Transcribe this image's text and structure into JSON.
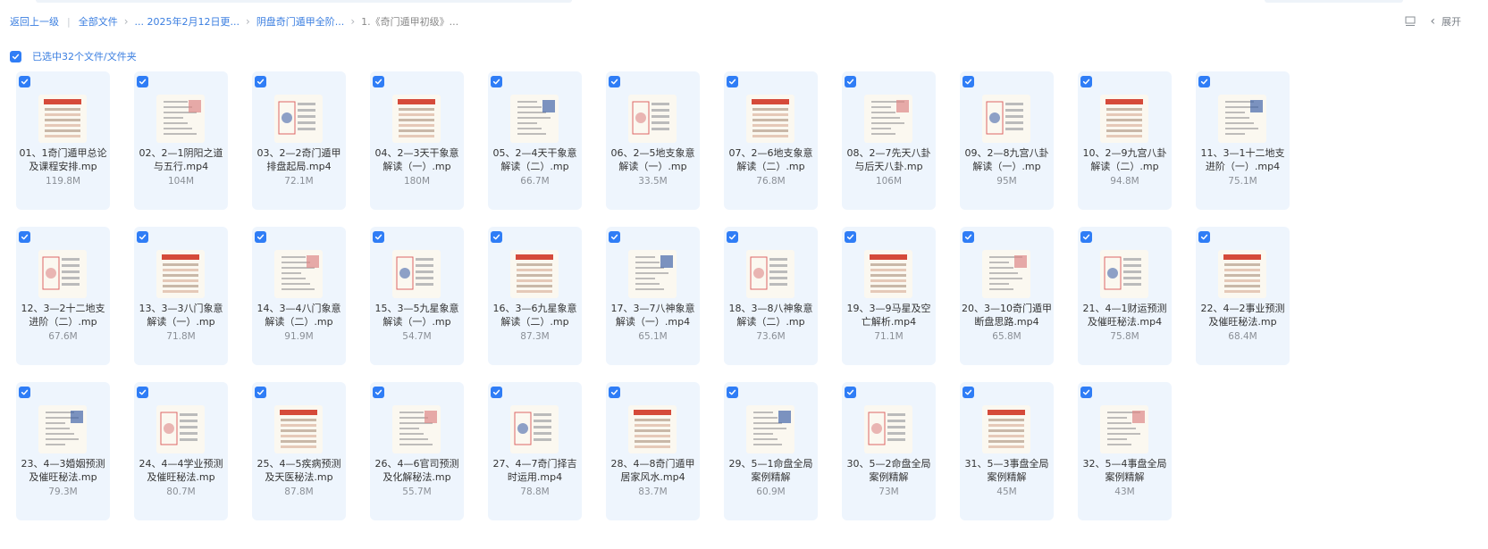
{
  "breadcrumb": {
    "back": "返回上一级",
    "items": [
      "全部文件",
      "... 2025年2月12日更...",
      "阴盘奇门遁甲全阶...",
      "1.《奇门遁甲初级》..."
    ]
  },
  "toolbar": {
    "view_icon": "list-view-icon",
    "expand_label": "展开"
  },
  "selection": {
    "label": "已选中32个文件/文件夹"
  },
  "colors": {
    "accent": "#2f7df6",
    "card_bg": "#eef5fd",
    "link": "#3a7ee0"
  },
  "files": [
    {
      "name": "01、1奇门遁甲总论及课程安排.mp",
      "size": "119.8M"
    },
    {
      "name": "02、2—1阴阳之道与五行.mp4",
      "size": "104M"
    },
    {
      "name": "03、2—2奇门遁甲排盘起局.mp4",
      "size": "72.1M"
    },
    {
      "name": "04、2—3天干象意解读（一）.mp",
      "size": "180M"
    },
    {
      "name": "05、2—4天干象意解读（二）.mp",
      "size": "66.7M"
    },
    {
      "name": "06、2—5地支象意解读（一）.mp",
      "size": "33.5M"
    },
    {
      "name": "07、2—6地支象意解读（二）.mp",
      "size": "76.8M"
    },
    {
      "name": "08、2—7先天八卦与后天八卦.mp",
      "size": "106M"
    },
    {
      "name": "09、2—8九宫八卦解读（一）.mp",
      "size": "95M"
    },
    {
      "name": "10、2—9九宫八卦解读（二）.mp",
      "size": "94.8M"
    },
    {
      "name": "11、3—1十二地支进阶（一）.mp4",
      "size": "75.1M"
    },
    {
      "name": "12、3—2十二地支进阶（二）.mp",
      "size": "67.6M"
    },
    {
      "name": "13、3—3八门象意解读（一）.mp",
      "size": "71.8M"
    },
    {
      "name": "14、3—4八门象意解读（二）.mp",
      "size": "91.9M"
    },
    {
      "name": "15、3—5九星象意解读（一）.mp",
      "size": "54.7M"
    },
    {
      "name": "16、3—6九星象意解读（二）.mp",
      "size": "87.3M"
    },
    {
      "name": "17、3—7八神象意解读（一）.mp4",
      "size": "65.1M"
    },
    {
      "name": "18、3—8八神象意解读（二）.mp",
      "size": "73.6M"
    },
    {
      "name": "19、3—9马星及空亡解析.mp4",
      "size": "71.1M"
    },
    {
      "name": "20、3—10奇门遁甲断盘思路.mp4",
      "size": "65.8M"
    },
    {
      "name": "21、4—1财运预测及催旺秘法.mp4",
      "size": "75.8M"
    },
    {
      "name": "22、4—2事业预测及催旺秘法.mp",
      "size": "68.4M"
    },
    {
      "name": "23、4—3婚姻预测及催旺秘法.mp",
      "size": "79.3M"
    },
    {
      "name": "24、4—4学业预测及催旺秘法.mp",
      "size": "80.7M"
    },
    {
      "name": "25、4—5疾病预测及天医秘法.mp",
      "size": "87.8M"
    },
    {
      "name": "26、4—6官司预测及化解秘法.mp",
      "size": "55.7M"
    },
    {
      "name": "27、4—7奇门择吉时运用.mp4",
      "size": "78.8M"
    },
    {
      "name": "28、4—8奇门遁甲居家风水.mp4",
      "size": "83.7M"
    },
    {
      "name": "29、5—1命盘全局案例精解",
      "size": "60.9M"
    },
    {
      "name": "30、5—2命盘全局案例精解",
      "size": "73M"
    },
    {
      "name": "31、5—3事盘全局案例精解",
      "size": "45M"
    },
    {
      "name": "32、5—4事盘全局案例精解",
      "size": "43M"
    }
  ]
}
